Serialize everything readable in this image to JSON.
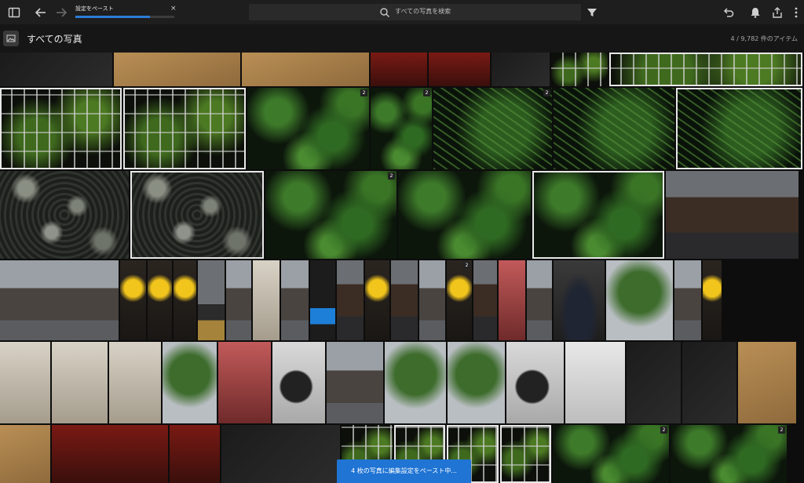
{
  "toolbar": {
    "progress_label": "設定をペースト",
    "progress_value": 0.75,
    "close_glyph": "×",
    "search_placeholder": "すべての写真を検索",
    "icons": [
      "sidebar-toggle-icon",
      "back-arrow-icon",
      "forward-arrow-icon",
      "search-icon",
      "filter-icon",
      "undo-icon",
      "bell-icon",
      "share-icon",
      "more-icon"
    ]
  },
  "header": {
    "title": "すべての写真",
    "count": "4 / 9,782 件のアイテム"
  },
  "photos": [
    {
      "tex": "t-dark"
    },
    {
      "tex": "t-wood"
    },
    {
      "tex": "t-wood"
    },
    {
      "tex": "t-red"
    },
    {
      "tex": "t-red"
    },
    {
      "tex": "t-dark"
    },
    {
      "tex": "t-grid"
    },
    {
      "tex": "t-grid",
      "selected": true
    },
    {
      "tex": "t-grid",
      "selected": true
    },
    {
      "tex": "t-grid",
      "selected": true
    },
    {
      "tex": "t-leaf",
      "badge": "2"
    },
    {
      "tex": "t-leaf",
      "badge": "2"
    },
    {
      "tex": "t-fern",
      "badge": "2"
    },
    {
      "tex": "t-fern"
    },
    {
      "tex": "t-fern",
      "selected": true
    },
    {
      "tex": "t-ivy"
    },
    {
      "tex": "t-ivy",
      "selected": true
    },
    {
      "tex": "t-leaf",
      "badge": "2"
    },
    {
      "tex": "t-leaf"
    },
    {
      "tex": "t-leaf",
      "selected": true
    },
    {
      "tex": "t-street"
    },
    {
      "tex": "t-street2"
    },
    {
      "tex": "t-lantern"
    },
    {
      "tex": "t-lantern"
    },
    {
      "tex": "t-lantern"
    },
    {
      "tex": "t-train"
    },
    {
      "tex": "t-street2"
    },
    {
      "tex": "t-building"
    },
    {
      "tex": "t-street2"
    },
    {
      "tex": "t-bus"
    },
    {
      "tex": "t-street"
    },
    {
      "tex": "t-lantern"
    },
    {
      "tex": "t-street"
    },
    {
      "tex": "t-street2"
    },
    {
      "tex": "t-lantern",
      "badge": "2"
    },
    {
      "tex": "t-street"
    },
    {
      "tex": "t-pink"
    },
    {
      "tex": "t-street2"
    },
    {
      "tex": "t-car"
    },
    {
      "tex": "t-tree"
    },
    {
      "tex": "t-street2"
    },
    {
      "tex": "t-lantern"
    },
    {
      "tex": "t-building"
    },
    {
      "tex": "t-building"
    },
    {
      "tex": "t-building"
    },
    {
      "tex": "t-tree"
    },
    {
      "tex": "t-pink"
    },
    {
      "tex": "t-camera"
    },
    {
      "tex": "t-street2"
    },
    {
      "tex": "t-tree"
    },
    {
      "tex": "t-tree"
    },
    {
      "tex": "t-camera"
    },
    {
      "tex": "t-bright"
    },
    {
      "tex": "t-dark"
    }
  ],
  "toast": {
    "message": "4 枚の写真に編集設定をペースト中..."
  }
}
